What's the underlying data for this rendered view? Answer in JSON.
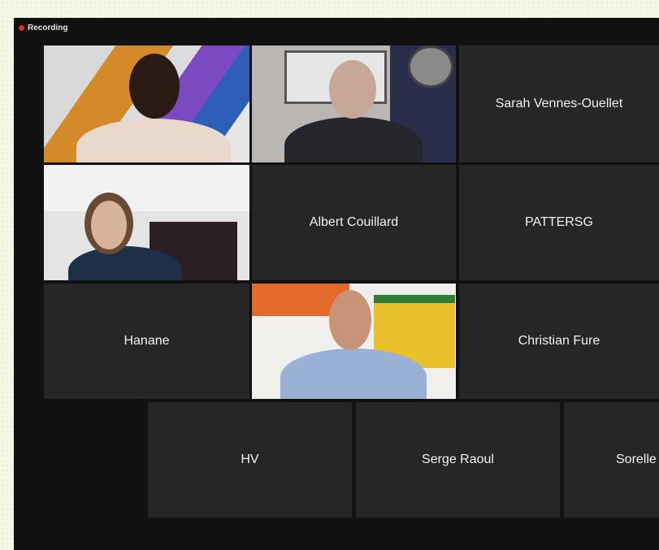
{
  "recording": {
    "label": "Recording"
  },
  "participants": [
    {
      "name": "",
      "video": true
    },
    {
      "name": "",
      "video": true
    },
    {
      "name": "Sarah Vennes-Ouellet",
      "video": false
    },
    {
      "name": "",
      "video": true
    },
    {
      "name": "Albert Couillard",
      "video": false
    },
    {
      "name": "PATTERSG",
      "video": false
    },
    {
      "name": "Hanane",
      "video": false
    },
    {
      "name": "",
      "video": true
    },
    {
      "name": "Christian Fure",
      "video": false
    },
    {
      "name": "HV",
      "video": false
    },
    {
      "name": "Serge Raoul",
      "video": false
    },
    {
      "name": "Sorelle",
      "video": false
    }
  ],
  "colors": {
    "tile": "#262626",
    "active_border": "#c8e04a",
    "rec_dot": "#e02b2b"
  }
}
